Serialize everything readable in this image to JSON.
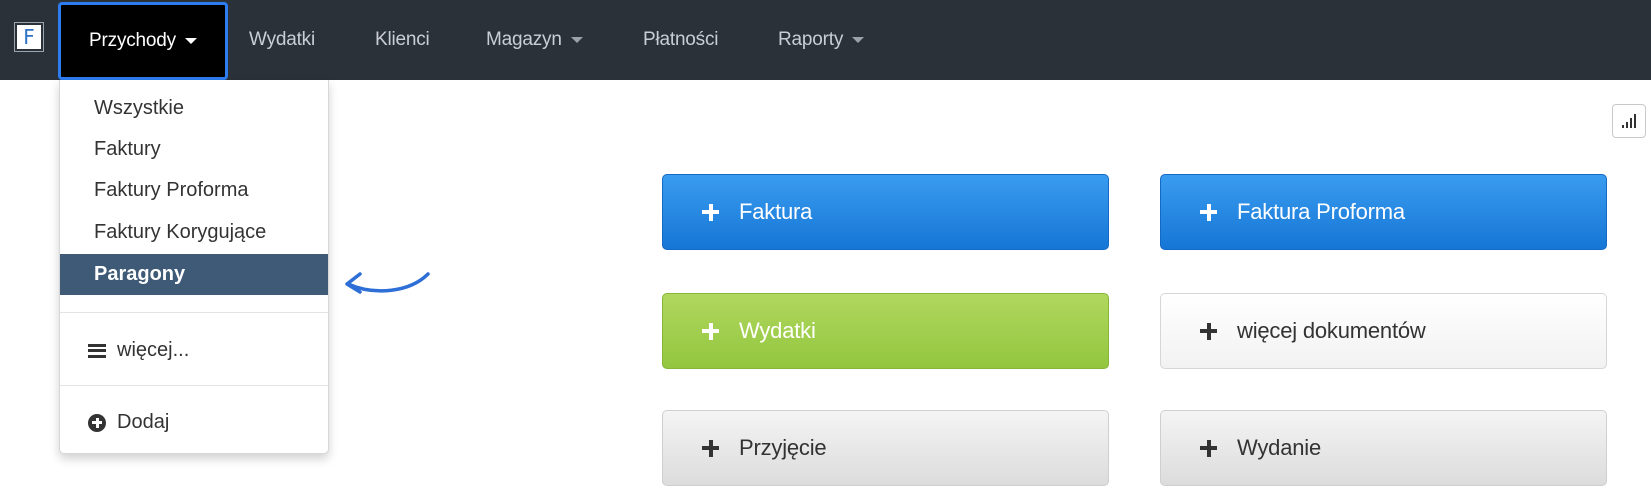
{
  "navbar": {
    "brand": "F",
    "items": [
      {
        "label": "Przychody",
        "has_caret": true,
        "active": true
      },
      {
        "label": "Wydatki",
        "has_caret": false
      },
      {
        "label": "Klienci",
        "has_caret": false
      },
      {
        "label": "Magazyn",
        "has_caret": true
      },
      {
        "label": "Płatności",
        "has_caret": false
      },
      {
        "label": "Raporty",
        "has_caret": true
      }
    ]
  },
  "dropdown": {
    "items": [
      {
        "label": "Wszystkie"
      },
      {
        "label": "Faktury"
      },
      {
        "label": "Faktury Proforma"
      },
      {
        "label": "Faktury Korygujące"
      },
      {
        "label": "Paragony",
        "selected": true
      }
    ],
    "more_label": "więcej...",
    "add_label": "Dodaj"
  },
  "actions": [
    {
      "label": "Faktura",
      "style": "blue"
    },
    {
      "label": "Faktura Proforma",
      "style": "blue"
    },
    {
      "label": "Wydatki",
      "style": "green"
    },
    {
      "label": "więcej dokumentów",
      "style": "white"
    },
    {
      "label": "Przyjęcie",
      "style": "gray"
    },
    {
      "label": "Wydanie",
      "style": "gray"
    }
  ],
  "colors": {
    "navbar_bg": "#2b3138",
    "active_outline": "#2d7cf0",
    "selected_item_bg": "#3e5a76",
    "primary_blue": "#1e84e0",
    "success_green": "#9fcd4f",
    "annotation_arrow": "#2d6fd6"
  },
  "icons": {
    "brand": "f-logo-icon",
    "more": "menu-lines-icon",
    "add": "plus-circle-icon",
    "action": "plus-icon",
    "stats": "signal-bars-icon",
    "annotation": "curved-arrow-icon"
  }
}
